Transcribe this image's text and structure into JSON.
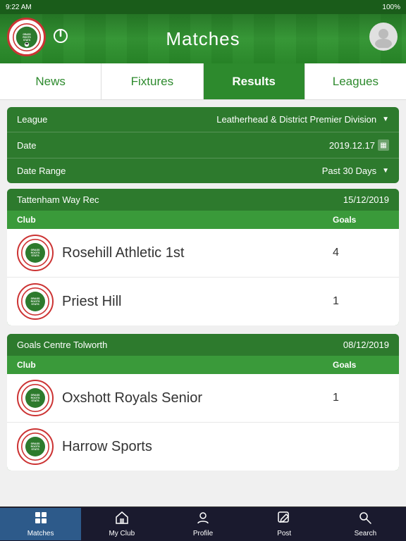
{
  "statusBar": {
    "time": "9:22 AM",
    "battery": "100%"
  },
  "header": {
    "title": "Matches",
    "logoAlt": "Grass Roots Stats"
  },
  "tabs": [
    {
      "id": "news",
      "label": "News",
      "active": false
    },
    {
      "id": "fixtures",
      "label": "Fixtures",
      "active": false
    },
    {
      "id": "results",
      "label": "Results",
      "active": true
    },
    {
      "id": "leagues",
      "label": "Leagues",
      "active": false
    }
  ],
  "filters": {
    "league": {
      "label": "League",
      "value": "Leatherhead & District Premier Division",
      "hasChevron": true
    },
    "date": {
      "label": "Date",
      "value": "2019.12.17",
      "hasCalendar": true
    },
    "dateRange": {
      "label": "Date Range",
      "value": "Past 30 Days",
      "hasChevron": true
    }
  },
  "matchCards": [
    {
      "id": "card1",
      "venue": "Tattenham Way Rec",
      "date": "15/12/2019",
      "columns": {
        "club": "Club",
        "goals": "Goals"
      },
      "teams": [
        {
          "name": "Rosehill Athletic 1st",
          "goals": "4"
        },
        {
          "name": "Priest Hill",
          "goals": "1"
        }
      ]
    },
    {
      "id": "card2",
      "venue": "Goals Centre Tolworth",
      "date": "08/12/2019",
      "columns": {
        "club": "Club",
        "goals": "Goals"
      },
      "teams": [
        {
          "name": "Oxshott Royals Senior",
          "goals": "1"
        },
        {
          "name": "Harrow Sports",
          "goals": ""
        }
      ]
    }
  ],
  "bottomNav": [
    {
      "id": "matches",
      "label": "Matches",
      "icon": "⊞",
      "active": true
    },
    {
      "id": "my-club",
      "label": "My Club",
      "icon": "🏠",
      "active": false
    },
    {
      "id": "profile",
      "label": "Profile",
      "icon": "👤",
      "active": false
    },
    {
      "id": "post",
      "label": "Post",
      "icon": "✏",
      "active": false
    },
    {
      "id": "search",
      "label": "Search",
      "icon": "🔍",
      "active": false
    }
  ]
}
